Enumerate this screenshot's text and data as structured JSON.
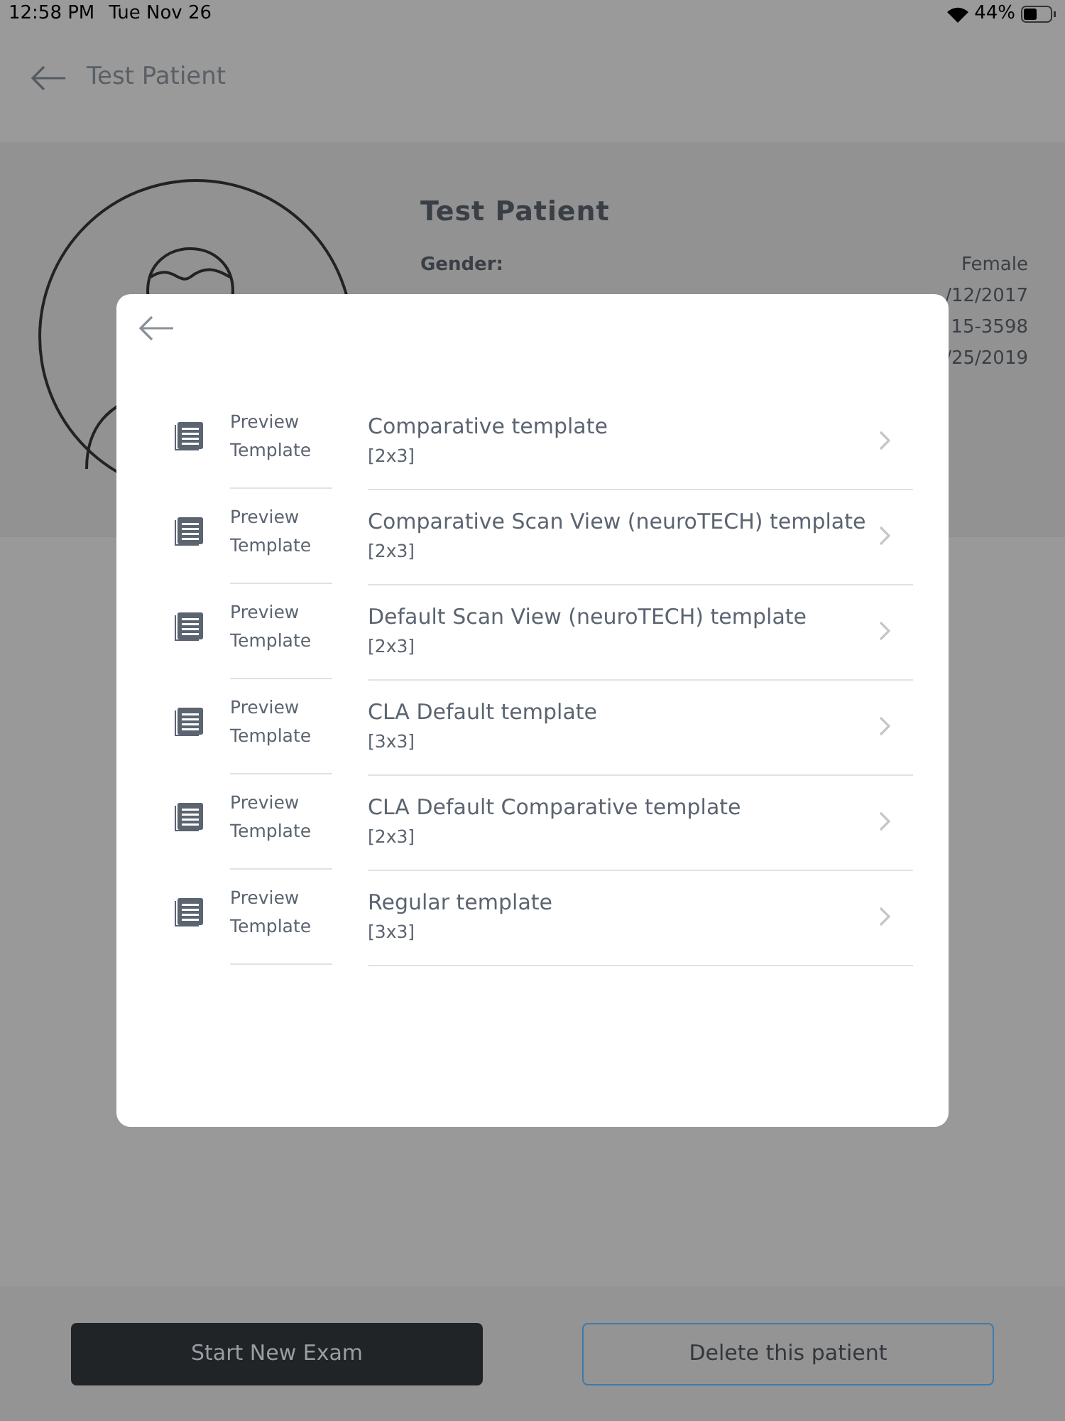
{
  "status_bar": {
    "time": "12:58 PM",
    "date": "Tue Nov 26",
    "battery": "44%"
  },
  "header": {
    "title": "Test Patient"
  },
  "patient": {
    "name": "Test Patient",
    "fields": [
      {
        "label": "Gender:",
        "value": "Female"
      },
      {
        "value": "/12/2017"
      },
      {
        "value": "15-3598"
      },
      {
        "value": "/25/2019"
      }
    ]
  },
  "dialog": {
    "templates": [
      {
        "preview": "Preview Template",
        "name": "Comparative template",
        "grid": "[2x3]"
      },
      {
        "preview": "Preview Template",
        "name": "Comparative Scan View (neuroTECH) template",
        "grid": "[2x3]"
      },
      {
        "preview": "Preview Template",
        "name": "Default Scan View (neuroTECH) template",
        "grid": "[2x3]"
      },
      {
        "preview": "Preview Template",
        "name": "CLA Default template",
        "grid": "[3x3]"
      },
      {
        "preview": "Preview Template",
        "name": "CLA Default Comparative template",
        "grid": "[2x3]"
      },
      {
        "preview": "Preview Template",
        "name": "Regular template",
        "grid": "[3x3]"
      }
    ]
  },
  "actions": [
    {
      "label": "Start New Exam",
      "kind": "primary"
    },
    {
      "label": "Delete this patient",
      "kind": "outline"
    }
  ]
}
